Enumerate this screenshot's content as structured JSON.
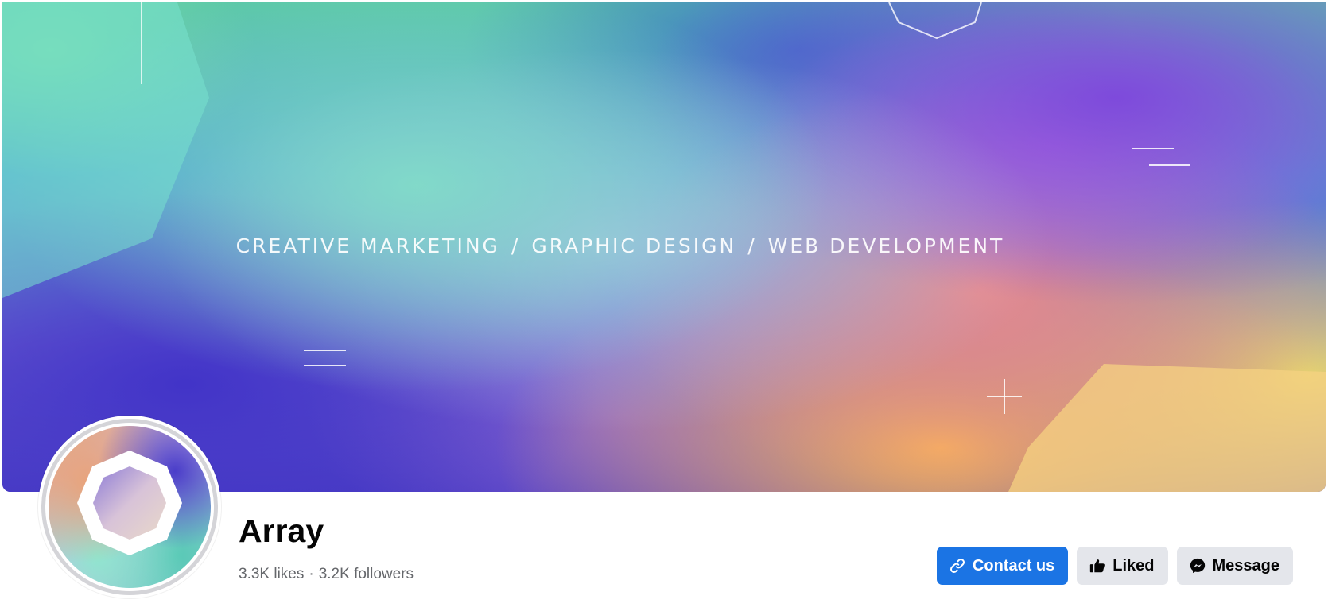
{
  "cover": {
    "tagline_parts": [
      "CREATIVE MARKETING",
      "GRAPHIC DESIGN",
      "WEB DEVELOPMENT"
    ],
    "separator": "/"
  },
  "page": {
    "name": "Array",
    "likes": "3.3K likes",
    "followers": "3.2K followers",
    "stats_separator": "·"
  },
  "actions": {
    "contact_label": "Contact us",
    "liked_label": "Liked",
    "message_label": "Message"
  },
  "colors": {
    "primary_button": "#1b74e4",
    "secondary_button": "#e4e6eb",
    "muted_text": "#65676b"
  },
  "icons": {
    "contact": "link-icon",
    "liked": "thumbs-up-icon",
    "message": "messenger-icon"
  }
}
